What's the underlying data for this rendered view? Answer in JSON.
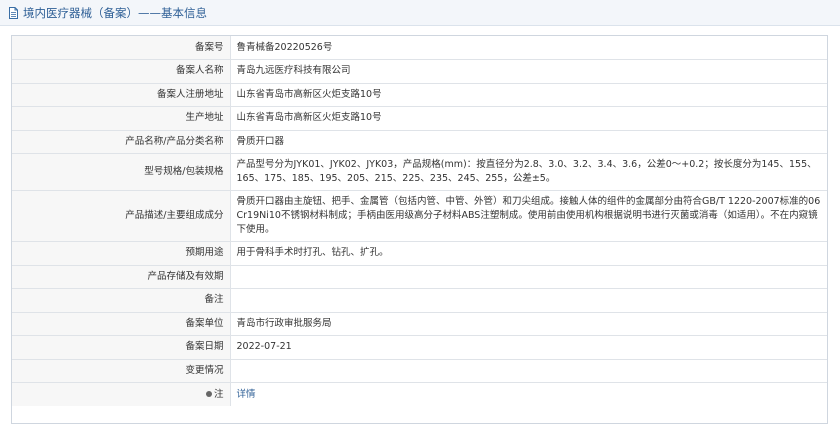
{
  "header": {
    "title": "境内医疗器械（备案）——基本信息"
  },
  "rows": [
    {
      "label": "备案号",
      "value": "鲁青械备20220526号"
    },
    {
      "label": "备案人名称",
      "value": "青岛九远医疗科技有限公司"
    },
    {
      "label": "备案人注册地址",
      "value": "山东省青岛市高新区火炬支路10号"
    },
    {
      "label": "生产地址",
      "value": "山东省青岛市高新区火炬支路10号"
    },
    {
      "label": "产品名称/产品分类名称",
      "value": "骨质开口器"
    },
    {
      "label": "型号规格/包装规格",
      "value": "产品型号分为JYK01、JYK02、JYK03，产品规格(mm)：按直径分为2.8、3.0、3.2、3.4、3.6，公差0～+0.2；按长度分为145、155、165、175、185、195、205、215、225、235、245、255，公差±5。"
    },
    {
      "label": "产品描述/主要组成成分",
      "value": "骨质开口器由主旋钮、把手、金属管（包括内管、中管、外管）和刀尖组成。接触人体的组件的金属部分由符合GB/T 1220-2007标准的06Cr19Ni10不锈钢材料制成；手柄由医用级高分子材料ABS注塑制成。使用前由使用机构根据说明书进行灭菌或消毒（如适用）。不在内窥镜下使用。"
    },
    {
      "label": "预期用途",
      "value": "用于骨科手术时打孔、钻孔、扩孔。"
    },
    {
      "label": "产品存储及有效期",
      "value": ""
    },
    {
      "label": "备注",
      "value": ""
    },
    {
      "label": "备案单位",
      "value": "青岛市行政审批服务局"
    },
    {
      "label": "备案日期",
      "value": "2022-07-21"
    },
    {
      "label": "变更情况",
      "value": ""
    }
  ],
  "note": {
    "label": "注",
    "link": "详情"
  }
}
